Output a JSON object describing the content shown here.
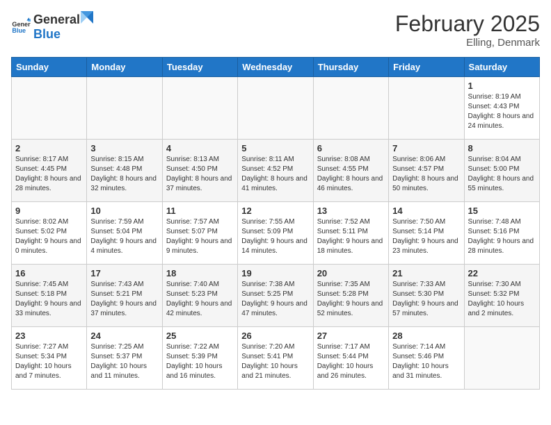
{
  "header": {
    "logo_general": "General",
    "logo_blue": "Blue",
    "month_title": "February 2025",
    "location": "Elling, Denmark"
  },
  "weekdays": [
    "Sunday",
    "Monday",
    "Tuesday",
    "Wednesday",
    "Thursday",
    "Friday",
    "Saturday"
  ],
  "weeks": [
    [
      {
        "day": "",
        "info": ""
      },
      {
        "day": "",
        "info": ""
      },
      {
        "day": "",
        "info": ""
      },
      {
        "day": "",
        "info": ""
      },
      {
        "day": "",
        "info": ""
      },
      {
        "day": "",
        "info": ""
      },
      {
        "day": "1",
        "info": "Sunrise: 8:19 AM\nSunset: 4:43 PM\nDaylight: 8 hours and 24 minutes."
      }
    ],
    [
      {
        "day": "2",
        "info": "Sunrise: 8:17 AM\nSunset: 4:45 PM\nDaylight: 8 hours and 28 minutes."
      },
      {
        "day": "3",
        "info": "Sunrise: 8:15 AM\nSunset: 4:48 PM\nDaylight: 8 hours and 32 minutes."
      },
      {
        "day": "4",
        "info": "Sunrise: 8:13 AM\nSunset: 4:50 PM\nDaylight: 8 hours and 37 minutes."
      },
      {
        "day": "5",
        "info": "Sunrise: 8:11 AM\nSunset: 4:52 PM\nDaylight: 8 hours and 41 minutes."
      },
      {
        "day": "6",
        "info": "Sunrise: 8:08 AM\nSunset: 4:55 PM\nDaylight: 8 hours and 46 minutes."
      },
      {
        "day": "7",
        "info": "Sunrise: 8:06 AM\nSunset: 4:57 PM\nDaylight: 8 hours and 50 minutes."
      },
      {
        "day": "8",
        "info": "Sunrise: 8:04 AM\nSunset: 5:00 PM\nDaylight: 8 hours and 55 minutes."
      }
    ],
    [
      {
        "day": "9",
        "info": "Sunrise: 8:02 AM\nSunset: 5:02 PM\nDaylight: 9 hours and 0 minutes."
      },
      {
        "day": "10",
        "info": "Sunrise: 7:59 AM\nSunset: 5:04 PM\nDaylight: 9 hours and 4 minutes."
      },
      {
        "day": "11",
        "info": "Sunrise: 7:57 AM\nSunset: 5:07 PM\nDaylight: 9 hours and 9 minutes."
      },
      {
        "day": "12",
        "info": "Sunrise: 7:55 AM\nSunset: 5:09 PM\nDaylight: 9 hours and 14 minutes."
      },
      {
        "day": "13",
        "info": "Sunrise: 7:52 AM\nSunset: 5:11 PM\nDaylight: 9 hours and 18 minutes."
      },
      {
        "day": "14",
        "info": "Sunrise: 7:50 AM\nSunset: 5:14 PM\nDaylight: 9 hours and 23 minutes."
      },
      {
        "day": "15",
        "info": "Sunrise: 7:48 AM\nSunset: 5:16 PM\nDaylight: 9 hours and 28 minutes."
      }
    ],
    [
      {
        "day": "16",
        "info": "Sunrise: 7:45 AM\nSunset: 5:18 PM\nDaylight: 9 hours and 33 minutes."
      },
      {
        "day": "17",
        "info": "Sunrise: 7:43 AM\nSunset: 5:21 PM\nDaylight: 9 hours and 37 minutes."
      },
      {
        "day": "18",
        "info": "Sunrise: 7:40 AM\nSunset: 5:23 PM\nDaylight: 9 hours and 42 minutes."
      },
      {
        "day": "19",
        "info": "Sunrise: 7:38 AM\nSunset: 5:25 PM\nDaylight: 9 hours and 47 minutes."
      },
      {
        "day": "20",
        "info": "Sunrise: 7:35 AM\nSunset: 5:28 PM\nDaylight: 9 hours and 52 minutes."
      },
      {
        "day": "21",
        "info": "Sunrise: 7:33 AM\nSunset: 5:30 PM\nDaylight: 9 hours and 57 minutes."
      },
      {
        "day": "22",
        "info": "Sunrise: 7:30 AM\nSunset: 5:32 PM\nDaylight: 10 hours and 2 minutes."
      }
    ],
    [
      {
        "day": "23",
        "info": "Sunrise: 7:27 AM\nSunset: 5:34 PM\nDaylight: 10 hours and 7 minutes."
      },
      {
        "day": "24",
        "info": "Sunrise: 7:25 AM\nSunset: 5:37 PM\nDaylight: 10 hours and 11 minutes."
      },
      {
        "day": "25",
        "info": "Sunrise: 7:22 AM\nSunset: 5:39 PM\nDaylight: 10 hours and 16 minutes."
      },
      {
        "day": "26",
        "info": "Sunrise: 7:20 AM\nSunset: 5:41 PM\nDaylight: 10 hours and 21 minutes."
      },
      {
        "day": "27",
        "info": "Sunrise: 7:17 AM\nSunset: 5:44 PM\nDaylight: 10 hours and 26 minutes."
      },
      {
        "day": "28",
        "info": "Sunrise: 7:14 AM\nSunset: 5:46 PM\nDaylight: 10 hours and 31 minutes."
      },
      {
        "day": "",
        "info": ""
      }
    ]
  ]
}
